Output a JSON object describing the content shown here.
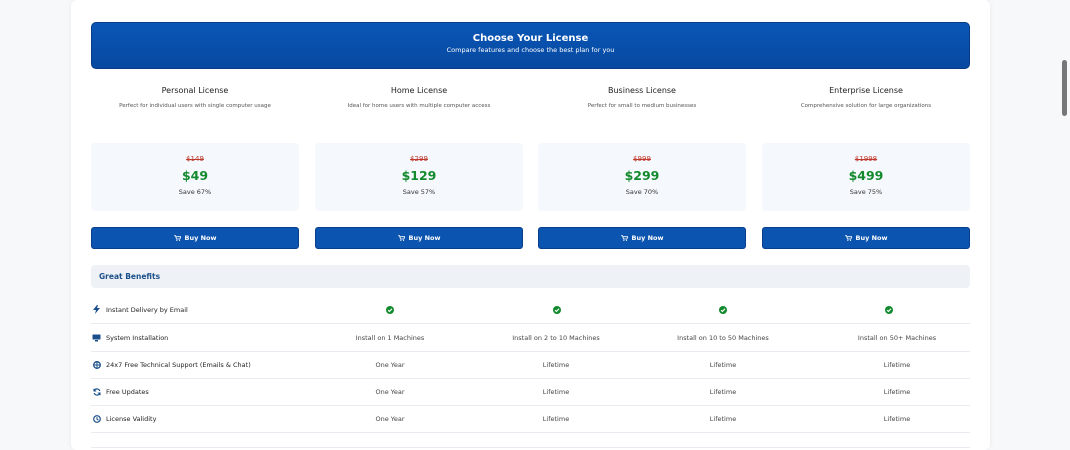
{
  "header": {
    "title": "Choose Your License",
    "subtitle": "Compare features and choose the best plan for you"
  },
  "plans": [
    {
      "name": "Personal License",
      "description": "Perfect for individual users with single computer usage",
      "old_price": "$149",
      "price": "$49",
      "save": "Save 67%",
      "button": "Buy Now"
    },
    {
      "name": "Home License",
      "description": "Ideal for home users with multiple computer access",
      "old_price": "$299",
      "price": "$129",
      "save": "Save 57%",
      "button": "Buy Now"
    },
    {
      "name": "Business License",
      "description": "Perfect for small to medium businesses",
      "old_price": "$999",
      "price": "$299",
      "save": "Save 70%",
      "button": "Buy Now"
    },
    {
      "name": "Enterprise License",
      "description": "Comprehensive solution for large organizations",
      "old_price": "$1998",
      "price": "$499",
      "save": "Save 75%",
      "button": "Buy Now"
    }
  ],
  "benefits": {
    "heading": "Great Benefits",
    "rows": [
      {
        "label": "Instant Delivery by Email",
        "icon": "bolt-icon",
        "values": [
          "check",
          "check",
          "check",
          "check"
        ]
      },
      {
        "label": "System Installation",
        "icon": "monitor-icon",
        "values": [
          "Install on 1 Machines",
          "Install on 2 to 10 Machines",
          "Install on 10 to 50 Machines",
          "Install on 50+ Machines"
        ]
      },
      {
        "label": "24x7 Free Technical Support (Emails & Chat)",
        "icon": "support-icon",
        "values": [
          "One Year",
          "Lifetime",
          "Lifetime",
          "Lifetime"
        ]
      },
      {
        "label": "Free Updates",
        "icon": "refresh-icon",
        "values": [
          "One Year",
          "Lifetime",
          "Lifetime",
          "Lifetime"
        ]
      },
      {
        "label": "License Validity",
        "icon": "clock-icon",
        "values": [
          "One Year",
          "Lifetime",
          "Lifetime",
          "Lifetime"
        ]
      }
    ]
  },
  "colors": {
    "primary": "#0b54b0",
    "price": "#138a2e",
    "old_price": "#c0392b",
    "check": "#138a2e"
  }
}
